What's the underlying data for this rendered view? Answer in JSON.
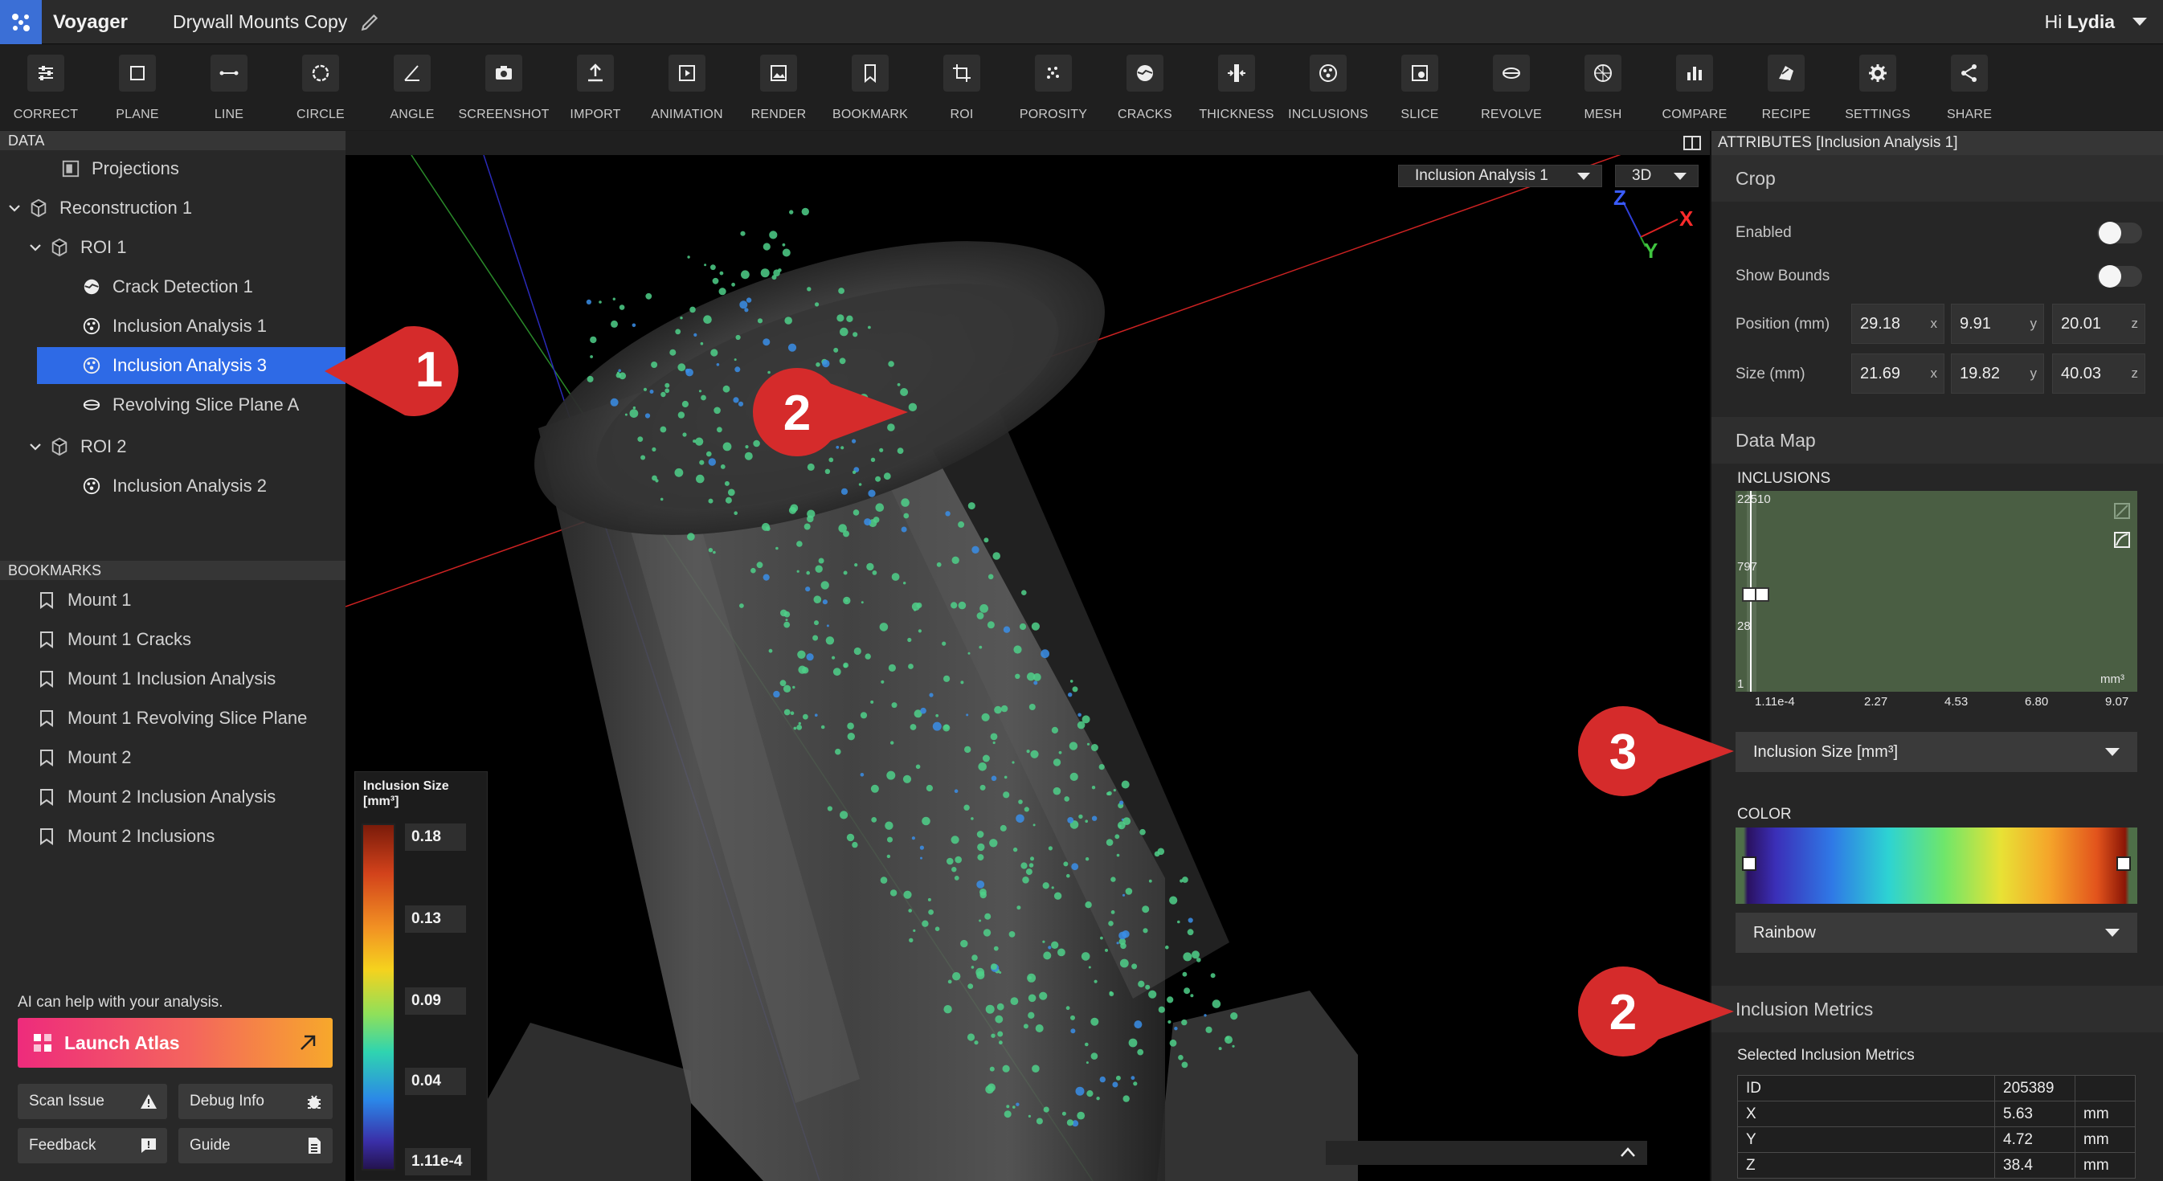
{
  "app": {
    "name": "Voyager",
    "document_title": "Drywall Mounts Copy",
    "greeting_prefix": "Hi ",
    "user_name": "Lydia",
    "accent_color": "#2e6ae6"
  },
  "toolbar": {
    "tools": [
      {
        "label": "CORRECT",
        "icon": "sliders-icon"
      },
      {
        "label": "PLANE",
        "icon": "plane-icon"
      },
      {
        "label": "LINE",
        "icon": "line-icon"
      },
      {
        "label": "CIRCLE",
        "icon": "circle-icon"
      },
      {
        "label": "ANGLE",
        "icon": "angle-icon"
      },
      {
        "label": "SCREENSHOT",
        "icon": "camera-icon"
      },
      {
        "label": "IMPORT",
        "icon": "upload-icon"
      },
      {
        "label": "ANIMATION",
        "icon": "play-icon"
      },
      {
        "label": "RENDER",
        "icon": "image-icon"
      },
      {
        "label": "BOOKMARK",
        "icon": "bookmark-icon"
      },
      {
        "label": "ROI",
        "icon": "crop-icon"
      },
      {
        "label": "POROSITY",
        "icon": "porosity-icon"
      },
      {
        "label": "CRACKS",
        "icon": "cracks-icon"
      },
      {
        "label": "THICKNESS",
        "icon": "thickness-icon"
      },
      {
        "label": "INCLUSIONS",
        "icon": "inclusions-icon"
      },
      {
        "label": "SLICE",
        "icon": "slice-icon"
      },
      {
        "label": "REVOLVE",
        "icon": "revolve-icon"
      },
      {
        "label": "MESH",
        "icon": "mesh-icon"
      },
      {
        "label": "COMPARE",
        "icon": "bar-chart-icon"
      },
      {
        "label": "RECIPE",
        "icon": "recipe-icon"
      },
      {
        "label": "SETTINGS",
        "icon": "gear-icon"
      },
      {
        "label": "SHARE",
        "icon": "share-icon"
      }
    ]
  },
  "data_panel": {
    "header": "DATA",
    "tree": [
      {
        "label": "Projections",
        "icon": "projections-icon",
        "depth": 1,
        "caret": false,
        "selected": false
      },
      {
        "label": "Reconstruction 1",
        "icon": "cube-icon",
        "depth": 0,
        "caret": true,
        "selected": false
      },
      {
        "label": "ROI 1",
        "icon": "cube-icon",
        "depth": 1,
        "caret": true,
        "selected": false
      },
      {
        "label": "Crack Detection 1",
        "icon": "cracks-icon",
        "depth": 2,
        "caret": false,
        "selected": false
      },
      {
        "label": "Inclusion Analysis 1",
        "icon": "inclusions-icon",
        "depth": 2,
        "caret": false,
        "selected": false
      },
      {
        "label": "Inclusion Analysis 3",
        "icon": "inclusions-icon",
        "depth": 2,
        "caret": false,
        "selected": true
      },
      {
        "label": "Revolving Slice Plane A",
        "icon": "revolve-icon",
        "depth": 2,
        "caret": false,
        "selected": false
      },
      {
        "label": "ROI 2",
        "icon": "cube-icon",
        "depth": 1,
        "caret": true,
        "selected": false
      },
      {
        "label": "Inclusion Analysis 2",
        "icon": "inclusions-icon",
        "depth": 2,
        "caret": false,
        "selected": false
      }
    ]
  },
  "bookmarks": {
    "header": "BOOKMARKS",
    "items": [
      "Mount 1",
      "Mount 1 Cracks",
      "Mount 1 Inclusion Analysis",
      "Mount 1 Revolving Slice Plane",
      "Mount 2",
      "Mount 2 Inclusion Analysis",
      "Mount 2 Inclusions"
    ]
  },
  "assistant": {
    "prompt": "AI can help with your analysis.",
    "launch_label": "Launch Atlas",
    "buttons": [
      {
        "label": "Scan Issue",
        "icon": "warning-icon"
      },
      {
        "label": "Debug Info",
        "icon": "bug-icon"
      },
      {
        "label": "Feedback",
        "icon": "feedback-icon"
      },
      {
        "label": "Guide",
        "icon": "document-icon"
      }
    ]
  },
  "viewport": {
    "analysis_select": "Inclusion Analysis 1",
    "view_mode": "3D",
    "axes": {
      "x": "X",
      "y": "Y",
      "z": "Z"
    },
    "legend": {
      "title_line1": "Inclusion Size",
      "title_line2": "[mm³]",
      "values": [
        "0.18",
        "0.13",
        "0.09",
        "0.04",
        "1.11e-4"
      ]
    }
  },
  "callouts": {
    "one": "1",
    "two_a": "2",
    "two_b": "2",
    "three": "3",
    "color": "#d52b2b"
  },
  "attributes": {
    "header": "ATTRIBUTES [Inclusion Analysis 1]",
    "crop": {
      "title": "Crop",
      "enabled_label": "Enabled",
      "enabled": false,
      "show_bounds_label": "Show Bounds",
      "show_bounds": false,
      "position_label": "Position (mm)",
      "position": {
        "x": "29.18",
        "y": "9.91",
        "z": "20.01"
      },
      "size_label": "Size (mm)",
      "size": {
        "x": "21.69",
        "y": "19.82",
        "z": "40.03"
      },
      "axis_labels": {
        "x": "x",
        "y": "y",
        "z": "z"
      }
    },
    "data_map": {
      "title": "Data Map",
      "chart_label": "INCLUSIONS",
      "y_ticks": [
        "22510",
        "797",
        "28",
        "1"
      ],
      "x_ticks": [
        "1.11e-4",
        "2.27",
        "4.53",
        "6.80",
        "9.07"
      ],
      "x_unit": "mm³",
      "metric_select": "Inclusion Size [mm³]",
      "color_label": "COLOR",
      "colormap_select": "Rainbow"
    },
    "metrics": {
      "title": "Inclusion Metrics",
      "subtitle": "Selected Inclusion Metrics",
      "rows": [
        {
          "name": "ID",
          "value": "205389",
          "unit": ""
        },
        {
          "name": "X",
          "value": "5.63",
          "unit": "mm"
        },
        {
          "name": "Y",
          "value": "4.72",
          "unit": "mm"
        },
        {
          "name": "Z",
          "value": "38.4",
          "unit": "mm"
        }
      ]
    }
  }
}
